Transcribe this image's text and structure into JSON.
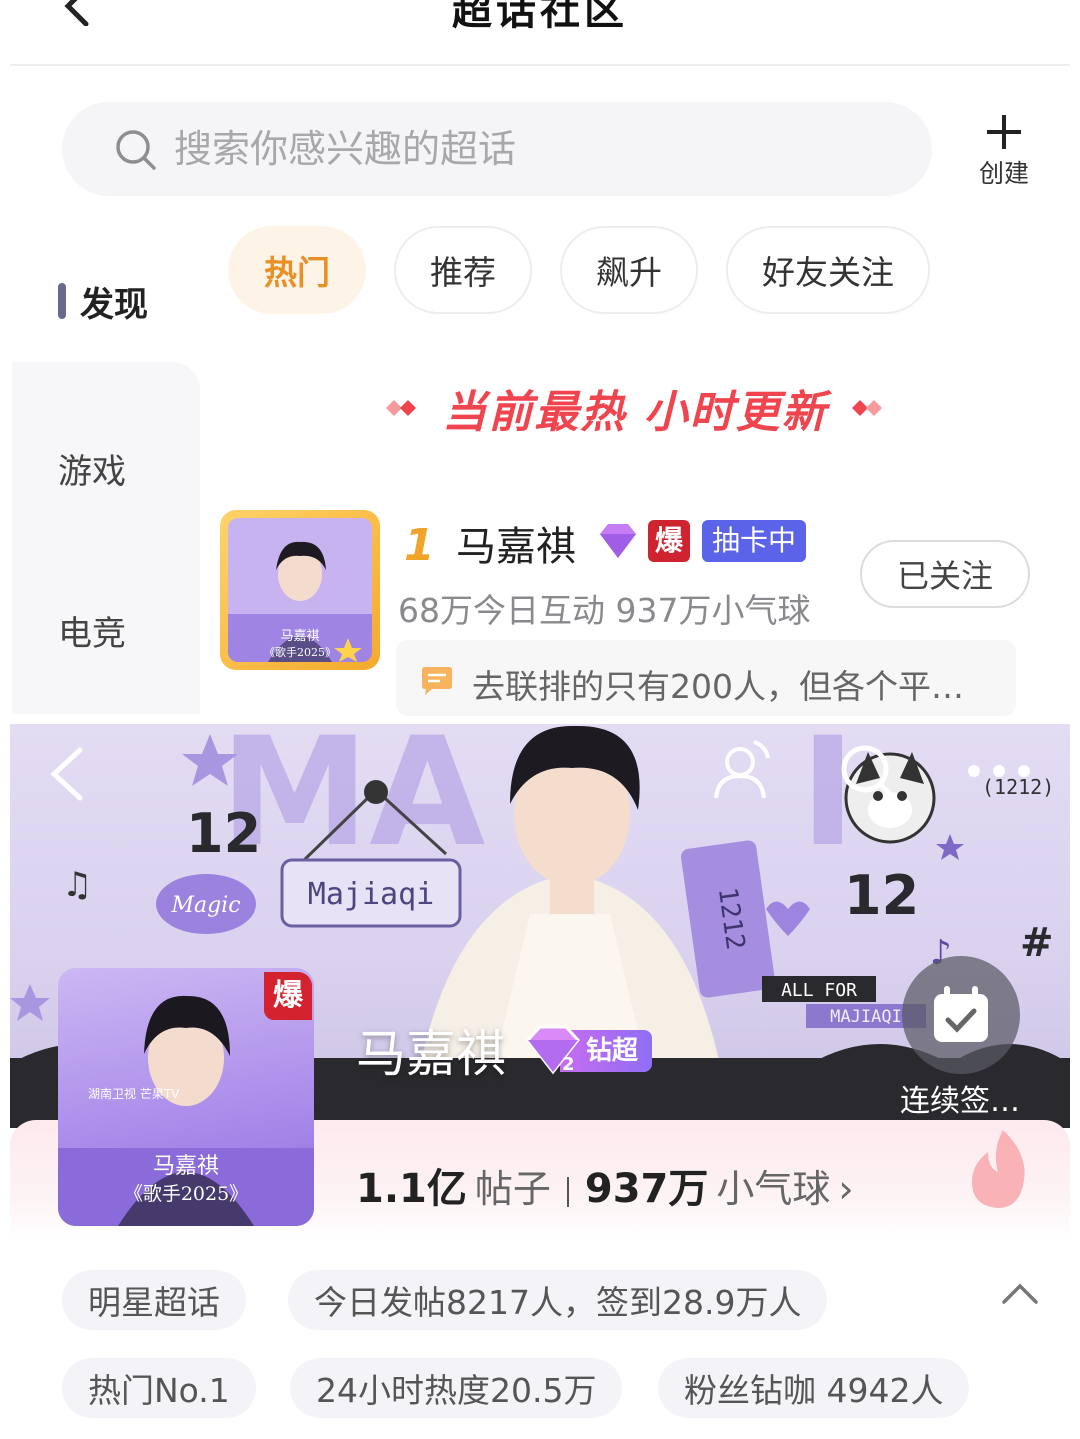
{
  "header": {
    "title": "超话社区"
  },
  "search": {
    "placeholder": "搜索你感兴趣的超话",
    "create_label": "创建"
  },
  "categories": {
    "active": "发现",
    "items": [
      "游戏",
      "电竞"
    ]
  },
  "tabs": [
    {
      "label": "热门",
      "active": true
    },
    {
      "label": "推荐",
      "active": false
    },
    {
      "label": "飙升",
      "active": false
    },
    {
      "label": "好友关注",
      "active": false
    }
  ],
  "hot_banner": "当前最热 小时更新",
  "top_item": {
    "rank": "1",
    "name": "马嘉祺",
    "bao": "爆",
    "card_badge": "抽卡中",
    "stats": "68万今日互动 937万小气球",
    "follow_label": "已关注",
    "comment": "去联排的只有200人，但各个平…",
    "cover_name": "马嘉祺",
    "cover_show": "《歌手2025》"
  },
  "topic": {
    "name": "马嘉祺",
    "bao": "爆",
    "level_badge": "钻超",
    "checkin_label": "连续签…",
    "cover_name": "马嘉祺",
    "cover_show": "《歌手2025》",
    "cover_text_small": "湖南卫视 芒果TV",
    "posts_value": "1.1亿",
    "posts_unit": "帖子",
    "balloons_value": "937万",
    "balloons_unit": "小气球",
    "hero_text": {
      "magic": "Magic",
      "majiaqi": "Majiaqi",
      "twelve": "12",
      "tag_1212": "1212",
      "all_for": "ALL FOR",
      "all_for_name": "MAJIAQI",
      "paren_1212": "(1212)",
      "hash": "#"
    }
  },
  "chips_row1": [
    "明星超话",
    "今日发帖8217人，签到28.9万人"
  ],
  "chips_row2": [
    "热门No.1",
    "24小时热度20.5万",
    "粉丝钻咖 4942人"
  ],
  "colors": {
    "accent_orange": "#e98f25",
    "hot_red": "#f0444e",
    "card_blue": "#5b63e8",
    "hero_purple": "#d9d1ee"
  }
}
